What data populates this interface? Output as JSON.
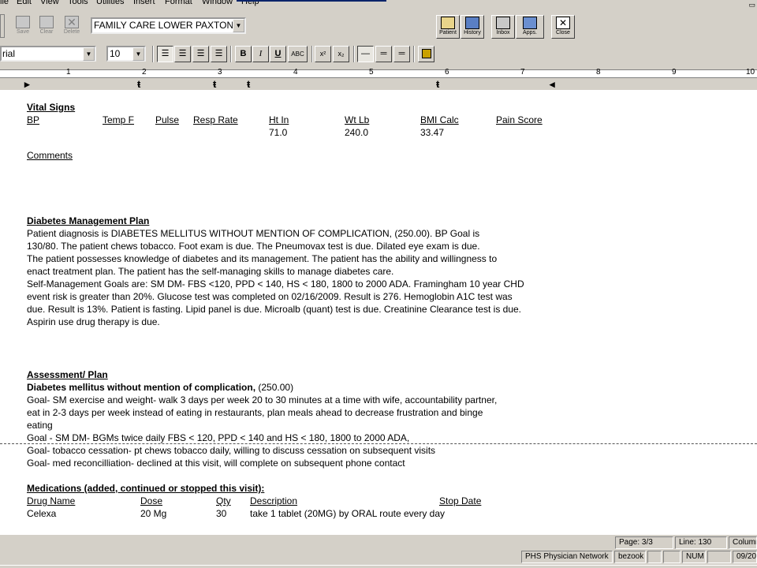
{
  "menu": [
    "ile",
    "Edit",
    "View",
    "Tools",
    "Utilities",
    "Insert",
    "Format",
    "Window",
    "Help"
  ],
  "toolbar": {
    "save_label": "Save",
    "clear_label": "Clear",
    "delete_label": "Delete",
    "clinic_value": "FAMILY CARE LOWER PAXTON",
    "patient_label": "Patient",
    "history_label": "History",
    "inbox_label": "Inbox",
    "apps_label": "Apps.",
    "close_label": "Close"
  },
  "format_bar": {
    "font_value": "rial",
    "size_value": "10",
    "bold_label": "B",
    "italic_label": "I",
    "underline_label": "U",
    "spell_label": "ABC",
    "superscript_label": "x²",
    "subscript_label": "x₂"
  },
  "ruler": {
    "numbers": [
      "1",
      "2",
      "3",
      "4",
      "5",
      "6",
      "7",
      "8",
      "9",
      "10"
    ]
  },
  "document": {
    "vital_signs": {
      "heading": "Vital Signs",
      "headers": [
        "BP",
        "Temp F",
        "Pulse",
        "Resp Rate",
        "Ht In",
        "Wt Lb",
        "BMI Calc",
        "Pain Score"
      ],
      "values": [
        "",
        "",
        "",
        "",
        "71.0",
        "240.0",
        "33.47",
        ""
      ]
    },
    "comments_heading": "Comments",
    "diabetes_plan": {
      "heading": "Diabetes Management Plan",
      "lines": [
        "Patient diagnosis is DIABETES MELLITUS WITHOUT MENTION OF COMPLICATION, (250.00).  BP Goal is",
        "130/80.  The patient chews tobacco.  Foot exam is due.  The Pneumovax test  is due.  Dilated eye exam is due.",
        "The patient possesses knowledge of diabetes and its management.  The patient has the ability and willingness to",
        "enact treatment plan.  The patient has the self-managing skills to manage diabetes care.",
        "Self-Management Goals are: SM DM- FBS <120, PPD < 140, HS < 180, 1800 to 2000 ADA. Framingham 10 year CHD",
        "event risk is greater than 20%.  Glucose test was completed on 02/16/2009.  Result is 276.  Hemoglobin A1C test was",
        "due.  Result is 13%.  Patient is fasting.  Lipid panel is due.  Microalb (quant) test is due.  Creatinine Clearance test is due.",
        "Aspirin use drug therapy is due."
      ]
    },
    "assessment": {
      "heading": "Assessment/ Plan",
      "dx_bold": "Diabetes mellitus without mention of complication,",
      "dx_code": " (250.00)",
      "lines": [
        "Goal- SM exercise and weight- walk 3 days per week 20 to 30 minutes at a time with wife, accountability partner,",
        "eat in 2-3 days per week instead of eating in restaurants, plan meals ahead to decrease frustration and binge",
        "eating",
        "Goal - SM DM- BGMs twice daily FBS < 120, PPD < 140 and HS < 180, 1800 to 2000 ADA,",
        "Goal- tobacco cessation- pt chews tobacco daily, willing to discuss cessation on subsequent visits",
        "Goal- med reconcilliation- declined at this visit, will complete on subsequent phone contact"
      ]
    },
    "medications": {
      "heading": "Medications (added, continued or stopped this visit):",
      "headers": [
        "Drug Name",
        "Dose",
        "Qty",
        "Description",
        "Stop Date"
      ],
      "rows": [
        [
          "Celexa",
          "20 Mg",
          "30",
          "take 1 tablet (20MG)  by ORAL route  every day",
          ""
        ]
      ]
    }
  },
  "statusbar": {
    "page": "Page: 3/3",
    "line": "Line: 130",
    "column": "Column",
    "network": "PHS Physician Network",
    "user": "bezook",
    "num": "NUM",
    "date": "09/20"
  }
}
